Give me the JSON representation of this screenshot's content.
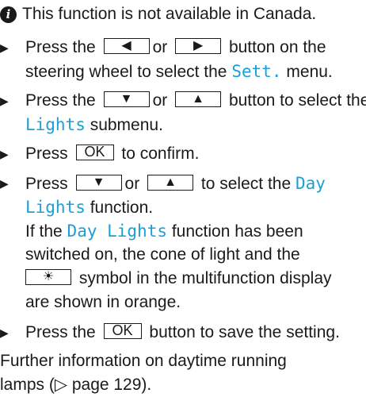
{
  "note": {
    "icon": "info-circle-icon",
    "text": "This function is not available in Canada."
  },
  "step1": {
    "a": "Press the",
    "key_left": "◀",
    "or": "or",
    "key_right": "▶",
    "b": "button on the",
    "c": "steering wheel to select the",
    "menu": "Sett.",
    "d": "menu."
  },
  "step2": {
    "a": "Press the",
    "key_down": "▼",
    "or": "or",
    "key_up": "▲",
    "b": "button to select the",
    "menu": "Lights",
    "c": "submenu."
  },
  "step3": {
    "a": "Press",
    "key_ok": "OK",
    "b": "to confirm."
  },
  "step4": {
    "a": "Press",
    "key_down": "▼",
    "or": "or",
    "key_up": "▲",
    "b": "to select the",
    "menu1": "Day",
    "menu2": "Lights",
    "c": "function.",
    "d": "If the",
    "menu3": "Day Lights",
    "e": "function has been",
    "f": "switched on, the cone of light and the",
    "key_sym": "☀",
    "g": "symbol in the multifunction display",
    "h": "are shown in orange."
  },
  "step5": {
    "a": "Press the",
    "key_ok": "OK",
    "b": "button to save the setting."
  },
  "footer": {
    "line1": "Further information on daytime running",
    "line2": "lamps (▷ page 129)."
  },
  "colors": {
    "display_text": "#1aa0d8",
    "text": "#1a1a1a"
  }
}
